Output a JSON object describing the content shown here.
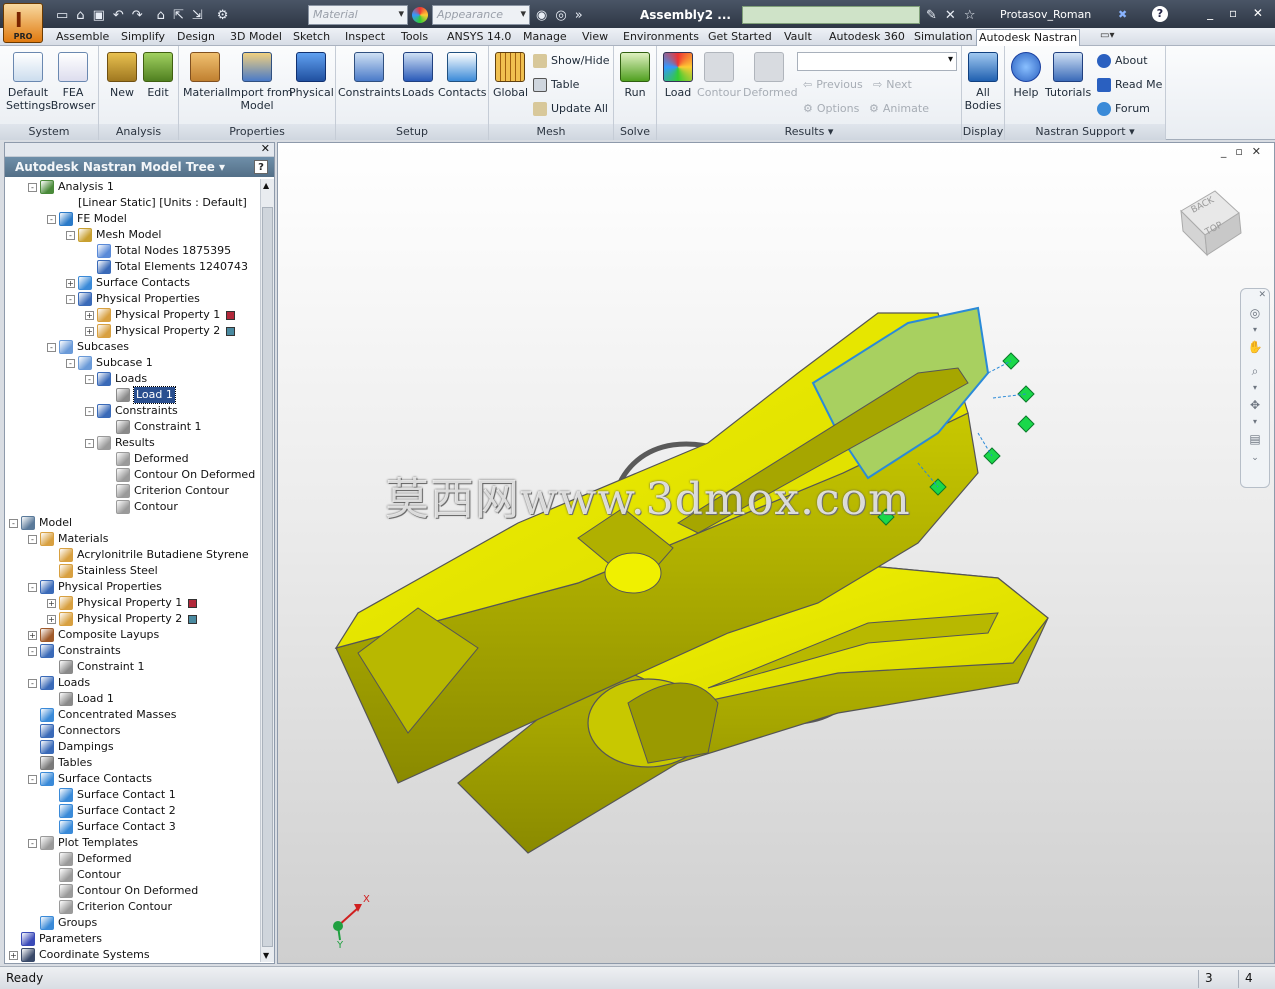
{
  "titlebar": {
    "doc_title": "Assembly2 ...",
    "material_placeholder": "Material",
    "appearance_placeholder": "Appearance",
    "user": "Protasov_Roman",
    "app_badge": "PRO"
  },
  "tabs": [
    "Assemble",
    "Simplify",
    "Design",
    "3D Model",
    "Sketch",
    "Inspect",
    "Tools",
    "ANSYS 14.0",
    "Manage",
    "View",
    "Environments",
    "Get Started",
    "Vault",
    "Autodesk 360",
    "Simulation",
    "Autodesk Nastran"
  ],
  "active_tab": "Autodesk Nastran",
  "ribbon": {
    "system": {
      "label": "System",
      "buttons": [
        "Default\nSettings",
        "FEA\nBrowser"
      ]
    },
    "analysis": {
      "label": "Analysis",
      "buttons": [
        "New",
        "Edit"
      ]
    },
    "properties": {
      "label": "Properties",
      "buttons": [
        "Material",
        "Import from\nModel",
        "Physical"
      ]
    },
    "setup": {
      "label": "Setup",
      "buttons": [
        "Constraints",
        "Loads",
        "Contacts"
      ]
    },
    "mesh": {
      "label": "Mesh",
      "global": "Global",
      "small": [
        "Show/Hide",
        "Table",
        "Update  All"
      ]
    },
    "solve": {
      "label": "Solve",
      "buttons": [
        "Run"
      ]
    },
    "results": {
      "label": "Results",
      "buttons": [
        "Load",
        "Contour",
        "Deformed"
      ],
      "small": [
        "Previous",
        "Next",
        "Options",
        "Animate"
      ]
    },
    "display": {
      "label": "Display",
      "buttons": [
        "All\nBodies"
      ]
    },
    "support": {
      "label": "Nastran Support",
      "buttons": [
        "Help",
        "Tutorials"
      ],
      "small": [
        "About",
        "Read Me",
        "Forum"
      ]
    }
  },
  "browser": {
    "title": "Autodesk Nastran Model Tree",
    "nodes": [
      {
        "label": "Analysis 1",
        "level": 1,
        "exp": "-",
        "icon": "analysis-icon",
        "color": "#4a8a3a"
      },
      {
        "label": "[Linear Static] [Units : Default]",
        "level": 3,
        "exp": "",
        "icon": "",
        "color": ""
      },
      {
        "label": "FE Model",
        "level": 2,
        "exp": "-",
        "icon": "fe-model-icon",
        "color": "#2a7ac8"
      },
      {
        "label": "Mesh Model",
        "level": 3,
        "exp": "-",
        "icon": "mesh-icon",
        "color": "#c8a030"
      },
      {
        "label": "Total Nodes 1875395",
        "level": 4,
        "exp": "",
        "icon": "node-dot-icon",
        "color": "#5a8ad8"
      },
      {
        "label": "Total Elements 1240743",
        "level": 4,
        "exp": "",
        "icon": "element-icon",
        "color": "#3a6ab8"
      },
      {
        "label": "Surface Contacts",
        "level": 3,
        "exp": "+",
        "icon": "surface-contact-icon",
        "color": "#3a8ad8"
      },
      {
        "label": "Physical Properties",
        "level": 3,
        "exp": "-",
        "icon": "physical-props-icon",
        "color": "#3a6ab8"
      },
      {
        "label": "Physical Property 1",
        "level": 4,
        "exp": "+",
        "icon": "property-icon",
        "color": "#d8a040",
        "swatch": "#b2283a"
      },
      {
        "label": "Physical Property 2",
        "level": 4,
        "exp": "+",
        "icon": "property-icon",
        "color": "#d8a040",
        "swatch": "#4a8aa0"
      },
      {
        "label": "Subcases",
        "level": 2,
        "exp": "-",
        "icon": "subcases-icon",
        "color": "#6a9ad8"
      },
      {
        "label": "Subcase 1",
        "level": 3,
        "exp": "-",
        "icon": "subcase-icon",
        "color": "#6a9ad8"
      },
      {
        "label": "Loads",
        "level": 4,
        "exp": "-",
        "icon": "loads-icon",
        "color": "#3a6ab8"
      },
      {
        "label": "Load 1",
        "level": 5,
        "exp": "",
        "icon": "load-icon",
        "color": "#8a8a8a",
        "selected": true
      },
      {
        "label": "Constraints",
        "level": 4,
        "exp": "-",
        "icon": "constraints-icon",
        "color": "#3a6ab8"
      },
      {
        "label": "Constraint 1",
        "level": 5,
        "exp": "",
        "icon": "constraint-icon",
        "color": "#8a8a8a"
      },
      {
        "label": "Results",
        "level": 4,
        "exp": "-",
        "icon": "results-icon",
        "color": "#9a9a9a"
      },
      {
        "label": "Deformed",
        "level": 5,
        "exp": "",
        "icon": "deformed-icon",
        "color": "#9a9a9a"
      },
      {
        "label": "Contour On Deformed",
        "level": 5,
        "exp": "",
        "icon": "contour-deformed-icon",
        "color": "#9a9a9a"
      },
      {
        "label": "Criterion Contour",
        "level": 5,
        "exp": "",
        "icon": "criterion-icon",
        "color": "#9a9a9a"
      },
      {
        "label": "Contour",
        "level": 5,
        "exp": "",
        "icon": "contour-icon",
        "color": "#9a9a9a"
      },
      {
        "label": "Model",
        "level": 0,
        "exp": "-",
        "icon": "model-icon",
        "color": "#5a7a9a"
      },
      {
        "label": "Materials",
        "level": 1,
        "exp": "-",
        "icon": "materials-icon",
        "color": "#d8a040"
      },
      {
        "label": "Acrylonitrile Butadiene Styrene",
        "level": 2,
        "exp": "",
        "icon": "material-icon",
        "color": "#d8a040"
      },
      {
        "label": "Stainless Steel",
        "level": 2,
        "exp": "",
        "icon": "material-icon",
        "color": "#d8a040"
      },
      {
        "label": "Physical Properties",
        "level": 1,
        "exp": "-",
        "icon": "physical-props-icon",
        "color": "#3a6ab8"
      },
      {
        "label": "Physical Property 1",
        "level": 2,
        "exp": "+",
        "icon": "property-icon",
        "color": "#d8a040",
        "swatch": "#b2283a"
      },
      {
        "label": "Physical Property 2",
        "level": 2,
        "exp": "+",
        "icon": "property-icon",
        "color": "#d8a040",
        "swatch": "#4a8aa0"
      },
      {
        "label": "Composite Layups",
        "level": 1,
        "exp": "+",
        "icon": "layup-icon",
        "color": "#a05a2a"
      },
      {
        "label": "Constraints",
        "level": 1,
        "exp": "-",
        "icon": "constraints-icon",
        "color": "#3a6ab8"
      },
      {
        "label": "Constraint 1",
        "level": 2,
        "exp": "",
        "icon": "constraint-icon",
        "color": "#8a8a8a"
      },
      {
        "label": "Loads",
        "level": 1,
        "exp": "-",
        "icon": "loads-icon",
        "color": "#3a6ab8"
      },
      {
        "label": "Load 1",
        "level": 2,
        "exp": "",
        "icon": "load-icon",
        "color": "#8a8a8a"
      },
      {
        "label": "Concentrated Masses",
        "level": 1,
        "exp": "",
        "icon": "mass-icon",
        "color": "#3a8ad8"
      },
      {
        "label": "Connectors",
        "level": 1,
        "exp": "",
        "icon": "connector-icon",
        "color": "#3a6ab8"
      },
      {
        "label": "Dampings",
        "level": 1,
        "exp": "",
        "icon": "damping-icon",
        "color": "#3a6ab8"
      },
      {
        "label": "Tables",
        "level": 1,
        "exp": "",
        "icon": "table-icon",
        "color": "#7a7a7a"
      },
      {
        "label": "Surface Contacts",
        "level": 1,
        "exp": "-",
        "icon": "surface-contact-icon",
        "color": "#3a8ad8"
      },
      {
        "label": "Surface Contact 1",
        "level": 2,
        "exp": "",
        "icon": "surface-contact-icon",
        "color": "#3a8ad8"
      },
      {
        "label": "Surface Contact 2",
        "level": 2,
        "exp": "",
        "icon": "surface-contact-icon",
        "color": "#3a8ad8"
      },
      {
        "label": "Surface Contact 3",
        "level": 2,
        "exp": "",
        "icon": "surface-contact-icon",
        "color": "#3a8ad8"
      },
      {
        "label": "Plot Templates",
        "level": 1,
        "exp": "-",
        "icon": "plot-templates-icon",
        "color": "#9a9a9a"
      },
      {
        "label": "Deformed",
        "level": 2,
        "exp": "",
        "icon": "deformed-icon",
        "color": "#9a9a9a"
      },
      {
        "label": "Contour",
        "level": 2,
        "exp": "",
        "icon": "contour-icon",
        "color": "#9a9a9a"
      },
      {
        "label": "Contour On Deformed",
        "level": 2,
        "exp": "",
        "icon": "contour-deformed-icon",
        "color": "#9a9a9a"
      },
      {
        "label": "Criterion Contour",
        "level": 2,
        "exp": "",
        "icon": "criterion-icon",
        "color": "#9a9a9a"
      },
      {
        "label": "Groups",
        "level": 1,
        "exp": "",
        "icon": "groups-icon",
        "color": "#3a8ad8"
      },
      {
        "label": "Parameters",
        "level": 0,
        "exp": "",
        "icon": "parameters-icon",
        "color": "#3a4ab8"
      },
      {
        "label": "Coordinate Systems",
        "level": 0,
        "exp": "+",
        "icon": "coordinate-icon",
        "color": "#3a4a6a"
      }
    ]
  },
  "viewport": {
    "watermark": "莫西网www.3dmox.com",
    "viewcube_top": "TOP",
    "viewcube_back": "BACK",
    "triad_x": "X",
    "triad_y": "Y"
  },
  "status": {
    "text": "Ready",
    "cell1": "3",
    "cell2": "4"
  },
  "colors": {
    "model_yellow": "#e6e600",
    "accent_green": "#a8d060",
    "marker_green": "#1ad84a",
    "edge_blue": "#2a8ad8"
  }
}
